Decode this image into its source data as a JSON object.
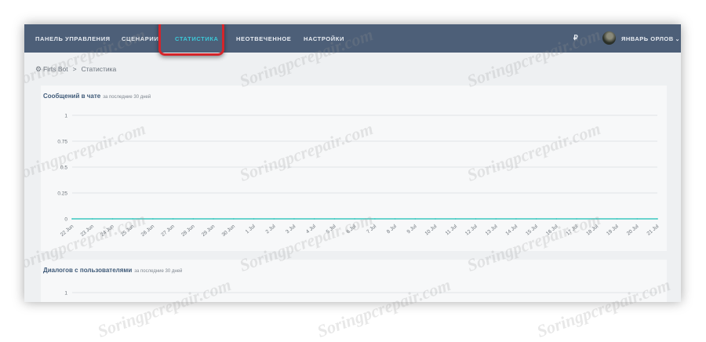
{
  "nav": {
    "items": [
      {
        "label": "ПАНЕЛЬ УПРАВЛЕНИЯ",
        "active": false
      },
      {
        "label": "СЦЕНАРИИ",
        "active": false
      },
      {
        "label": "СТАТИСТИКА",
        "active": true
      },
      {
        "label": "НЕОТВЕЧЕННОЕ",
        "active": false
      },
      {
        "label": "НАСТРОЙКИ",
        "active": false
      }
    ],
    "currency_symbol": "₽",
    "user_name": "ЯНВАРЬ ОРЛОВ",
    "user_caret": "⌄"
  },
  "breadcrumb": {
    "icon": "robot-icon",
    "bot": "Firts Bot",
    "separator": ">",
    "current": "Статистика"
  },
  "chart1": {
    "title": "Сообщений в чате",
    "subtitle": "за последние 30 дней"
  },
  "chart2": {
    "title": "Диалогов с пользователями",
    "subtitle": "за последние 30 дней"
  },
  "watermark": "Soringpcrepair.com",
  "colors": {
    "topbar": "#4d5f78",
    "active": "#3cc8d8",
    "highlight": "#d4242a",
    "line": "#3cc8c0"
  },
  "chart_data": [
    {
      "type": "line",
      "title": "Сообщений в чате",
      "x": [
        "22 Jun",
        "23 Jun",
        "24 Jun",
        "25 Jun",
        "26 Jun",
        "27 Jun",
        "28 Jun",
        "29 Jun",
        "30 Jun",
        "1 Jul",
        "2 Jul",
        "3 Jul",
        "4 Jul",
        "5 Jul",
        "6 Jul",
        "7 Jul",
        "8 Jul",
        "9 Jul",
        "10 Jul",
        "11 Jul",
        "12 Jul",
        "13 Jul",
        "14 Jul",
        "15 Jul",
        "16 Jul",
        "17 Jul",
        "18 Jul",
        "19 Jul",
        "20 Jul",
        "21 Jul"
      ],
      "y_ticks": [
        "1",
        "0.75",
        "0.5",
        "0.25",
        "0"
      ],
      "series": [
        {
          "values": [
            0,
            0,
            0,
            0,
            0,
            0,
            0,
            0,
            0,
            0,
            0,
            0,
            0,
            0,
            0,
            0,
            0,
            0,
            0,
            0,
            0,
            0,
            0,
            0,
            0,
            0,
            0,
            0,
            0,
            0
          ]
        }
      ],
      "ylim": [
        0,
        1
      ],
      "grid": true
    },
    {
      "type": "line",
      "title": "Диалогов с пользователями",
      "y_ticks": [
        "1"
      ],
      "ylim": [
        0,
        1
      ],
      "grid": true
    }
  ]
}
